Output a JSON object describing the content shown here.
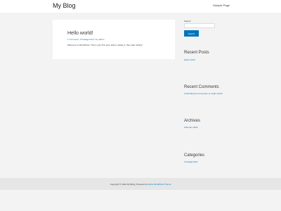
{
  "header": {
    "site_title": "My Blog",
    "nav": [
      "Sample Page"
    ]
  },
  "post": {
    "title": "Hello world!",
    "comments_link": "1 Comment",
    "separator1": " / ",
    "category_link": "Uncategorized",
    "separator2": " / By ",
    "author_link": "admin",
    "excerpt": "Welcome to WordPress. This is your first post. Edit or delete it, then start writing!"
  },
  "sidebar": {
    "search": {
      "label": "Search",
      "placeholder": "",
      "button_label": "Search"
    },
    "recent_posts": {
      "title": "Recent Posts",
      "items": [
        "Hello world!"
      ]
    },
    "recent_comments": {
      "title": "Recent Comments",
      "items": [
        "A WordPress Commenter on Hello world!"
      ]
    },
    "archives": {
      "title": "Archives",
      "items": [
        "February 2022"
      ]
    },
    "categories": {
      "title": "Categories",
      "items": [
        "Uncategorized"
      ]
    }
  },
  "footer": {
    "prefix": "Copyright © 2022 My Blog | Powered by ",
    "link": "Astra WordPress Theme"
  },
  "colors": {
    "accent": "#0274be",
    "page_background": "#f3f3f3",
    "card_background": "#ffffff",
    "footer_background": "#e6e6e6"
  }
}
